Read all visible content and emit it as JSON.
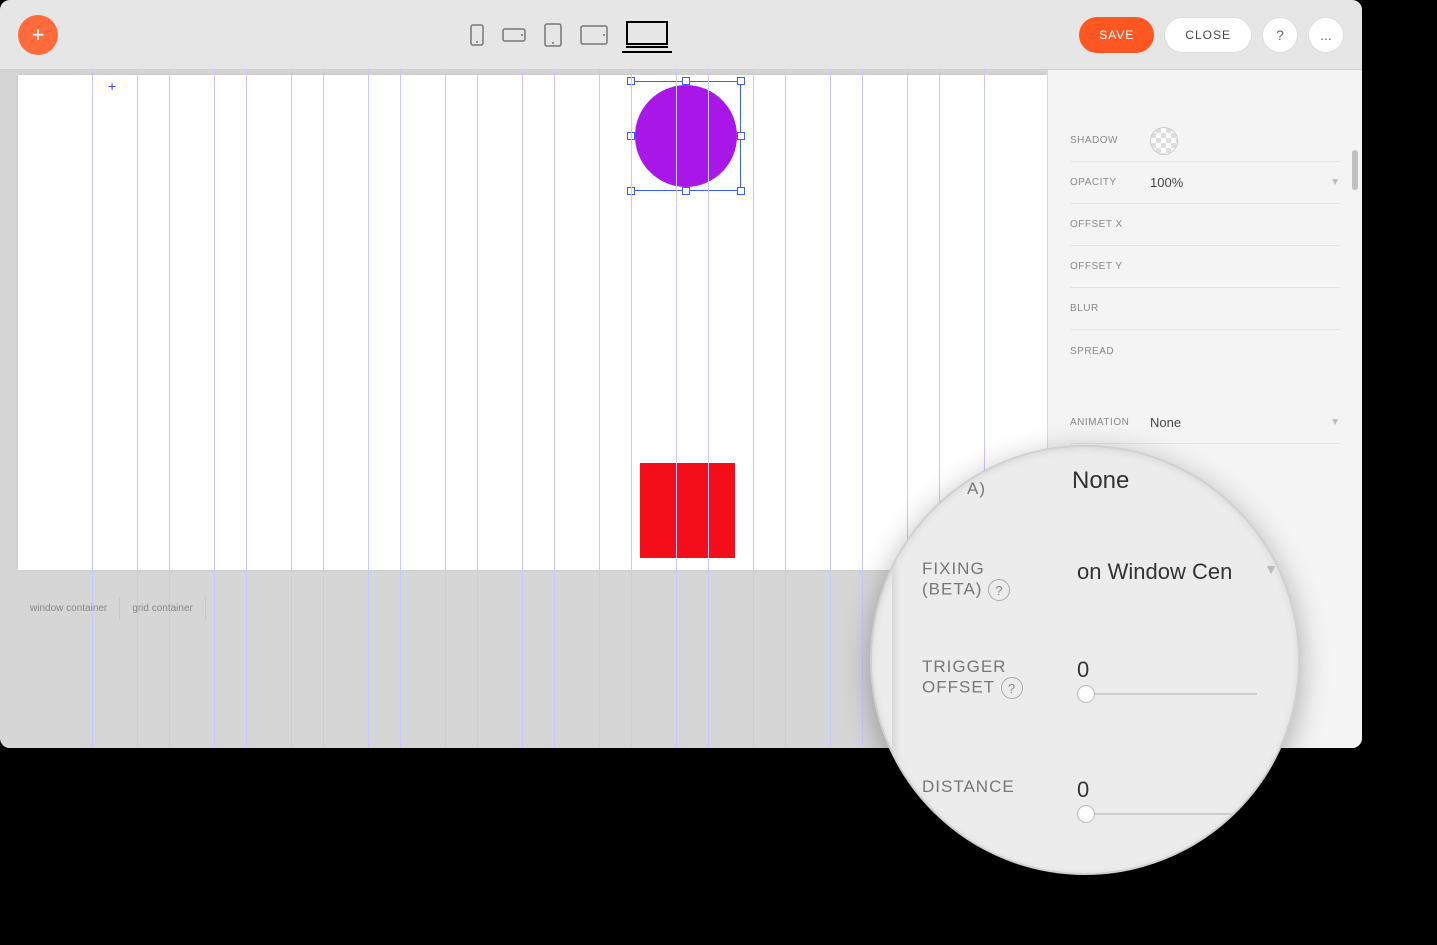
{
  "toolbar": {
    "add_icon": "+",
    "save_label": "SAVE",
    "close_label": "CLOSE",
    "help_label": "?",
    "more_label": "..."
  },
  "breadcrumb": {
    "items": [
      "window container",
      "grid container"
    ]
  },
  "panel": {
    "shadow_label": "SHADOW",
    "opacity_label": "OPACITY",
    "opacity_value": "100%",
    "offsetx_label": "OFFSET X",
    "offsety_label": "OFFSET Y",
    "blur_label": "BLUR",
    "spread_label": "SPREAD",
    "animation_label": "ANIMATION",
    "animation_value": "None"
  },
  "magnifier": {
    "top_none": "None",
    "partial_label": "A)",
    "fixing_label1": "FIXING",
    "fixing_label2": "(BETA)",
    "fixing_value": "on Window Cen",
    "trigger_label1": "TRIGGER",
    "trigger_label2": "OFFSET",
    "trigger_value": "0",
    "distance_label": "DISTANCE",
    "distance_value": "0",
    "help": "?"
  },
  "canvas": {
    "circle_color": "#a817e8",
    "square_color": "#f40e1a"
  }
}
